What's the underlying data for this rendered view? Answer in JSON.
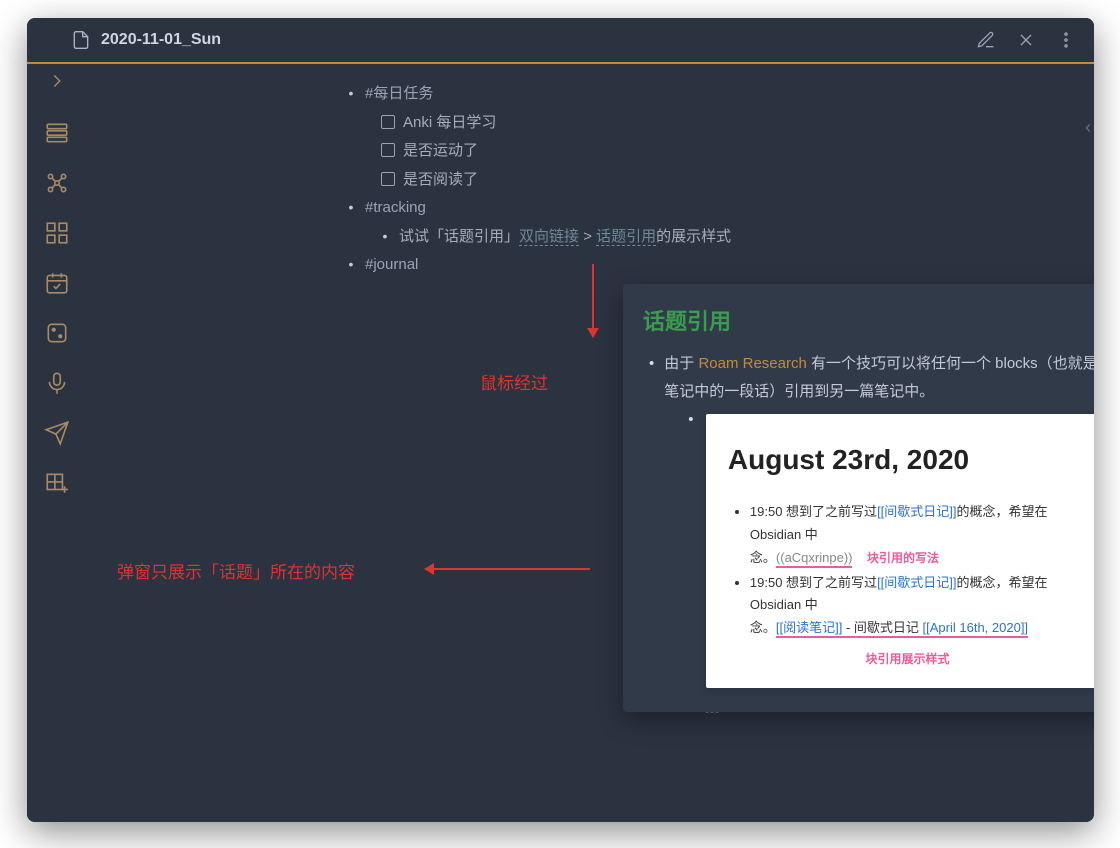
{
  "title": "2020-11-01_Sun",
  "tags": {
    "daily": "#每日任务",
    "tracking": "#tracking",
    "journal": "#journal"
  },
  "tasks": [
    "Anki 每日学习",
    "是否运动了",
    "是否阅读了"
  ],
  "tracking_line": {
    "prefix": "试试「话题引用」",
    "link1": "双向链接",
    "sep": " > ",
    "link2": "话题引用",
    "suffix": "的展示样式"
  },
  "anno": {
    "hover": "鼠标经过",
    "popup_desc": "弹窗只展示「话题」所在的内容"
  },
  "popover": {
    "title": "话题引用",
    "body_pre": "由于 ",
    "body_link": "Roam Research",
    "body_post": " 有一个技巧可以将任何一个 blocks（也就是笔记中的一段话）引用到另一篇笔记中。"
  },
  "embed": {
    "title": "August 23rd, 2020",
    "row1": {
      "time": "19:50",
      "a": " 想到了之前写过",
      "l1": "[[间歇式日记]]",
      "b": "的概念，希望在 Obsidian 中",
      "c": "念。",
      "code": "((aCqxrinpe))",
      "tag": "块引用的写法"
    },
    "row2": {
      "time": "19:50",
      "a": " 想到了之前写过",
      "l1": "[[间歇式日记]]",
      "b": "的概念，希望在 Obsidian 中",
      "c": "念。",
      "l2": "[[阅读笔记]]",
      "mid": " - 间歇式日记 ",
      "l3": "[[April 16th, 2020]]"
    },
    "tag2": "块引用展示样式"
  }
}
